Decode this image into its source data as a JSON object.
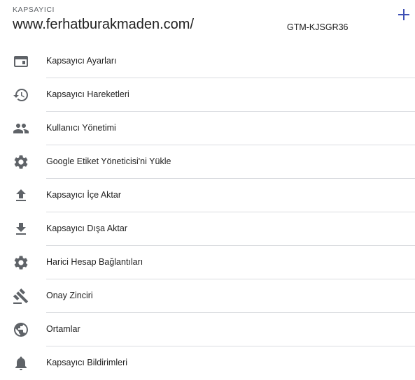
{
  "header": {
    "section_label": "KAPSAYICI",
    "container_name": "www.ferhatburakmaden.com/",
    "container_id": "GTM-KJSGR36",
    "add_icon": "plus-icon"
  },
  "colors": {
    "accent": "#3f51b5",
    "icon": "#5f6368",
    "divider": "#dadce0",
    "text": "#212121"
  },
  "menu": {
    "items": [
      {
        "label": "Kapsayıcı Ayarları",
        "icon": "browser-window-icon"
      },
      {
        "label": "Kapsayıcı Hareketleri",
        "icon": "history-icon"
      },
      {
        "label": "Kullanıcı Yönetimi",
        "icon": "people-icon"
      },
      {
        "label": "Google Etiket Yöneticisi'ni Yükle",
        "icon": "gear-icon"
      },
      {
        "label": "Kapsayıcı İçe Aktar",
        "icon": "upload-icon"
      },
      {
        "label": "Kapsayıcı Dışa Aktar",
        "icon": "download-icon"
      },
      {
        "label": "Harici Hesap Bağlantıları",
        "icon": "gear-icon"
      },
      {
        "label": "Onay Zinciri",
        "icon": "gavel-icon"
      },
      {
        "label": "Ortamlar",
        "icon": "globe-icon"
      },
      {
        "label": "Kapsayıcı Bildirimleri",
        "icon": "bell-icon"
      }
    ]
  }
}
